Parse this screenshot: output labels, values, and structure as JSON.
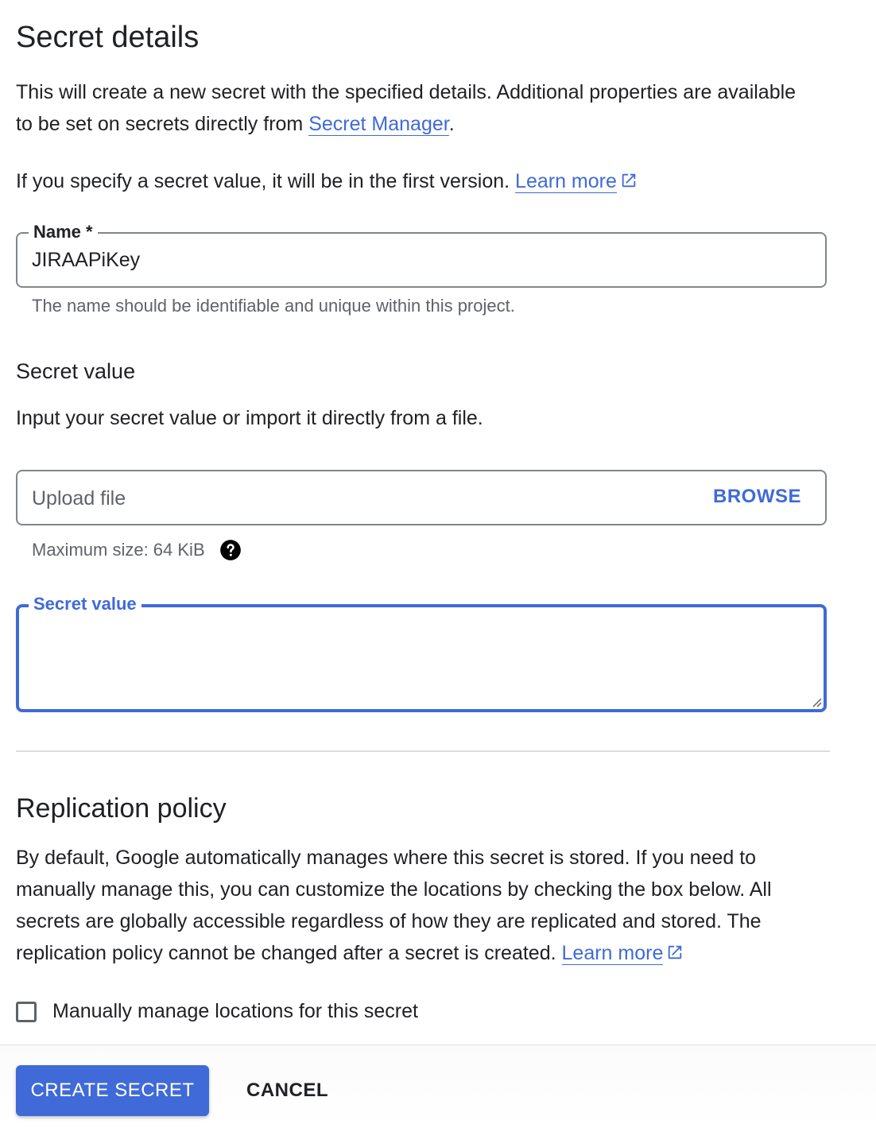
{
  "header": {
    "title": "Secret details"
  },
  "intro": {
    "text_before_link": "This will create a new secret with the specified details. Additional properties are available to be set on secrets directly from ",
    "link_label": "Secret Manager",
    "text_after_link": "."
  },
  "version_note": {
    "text": "If you specify a secret value, it will be in the first version. ",
    "link_label": "Learn more"
  },
  "name_field": {
    "label": "Name *",
    "value": "JIRAAPiKey",
    "hint": "The name should be identifiable and unique within this project."
  },
  "secret_value_section": {
    "heading": "Secret value",
    "description": "Input your secret value or import it directly from a file.",
    "upload": {
      "placeholder": "Upload file",
      "browse_label": "BROWSE",
      "hint": "Maximum size: 64 KiB"
    },
    "value_field": {
      "label": "Secret value",
      "value": ""
    }
  },
  "replication": {
    "heading": "Replication policy",
    "description": "By default, Google automatically manages where this secret is stored. If you need to manually manage this, you can customize the locations by checking the box below. All secrets are globally accessible regardless of how they are replicated and stored. The replication policy cannot be changed after a secret is created. ",
    "link_label": "Learn more",
    "checkbox_label": "Manually manage locations for this secret",
    "checkbox_checked": false
  },
  "footer": {
    "create_label": "CREATE SECRET",
    "cancel_label": "CANCEL"
  },
  "icons": {
    "external_link": "open-in-new-icon",
    "help": "help-icon"
  },
  "colors": {
    "accent": "#3f6ad8",
    "text": "#202124",
    "muted": "#5f6368",
    "border": "#80868b"
  }
}
